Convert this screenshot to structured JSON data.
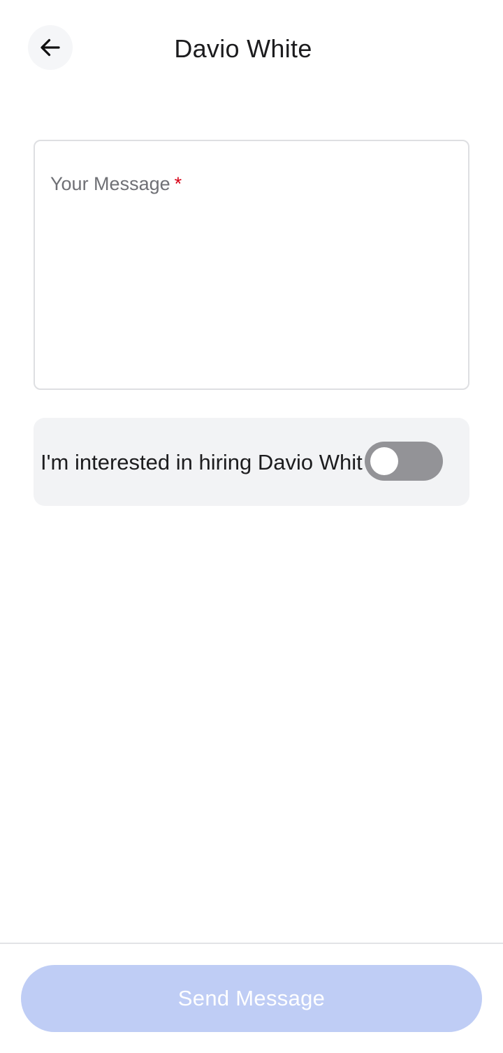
{
  "header": {
    "title": "Davio White",
    "back_icon": "arrow-left-icon"
  },
  "form": {
    "message_label": "Your Message",
    "required_mark": "*",
    "message_value": "",
    "hire_label": "I'm interested in hiring Davio White",
    "hire_toggle_on": false
  },
  "footer": {
    "send_label": "Send Message",
    "send_enabled": false
  },
  "colors": {
    "send_button_disabled": "#bfcdf5",
    "toggle_off": "#939397",
    "required": "#d70015",
    "row_background": "#f2f3f5"
  }
}
